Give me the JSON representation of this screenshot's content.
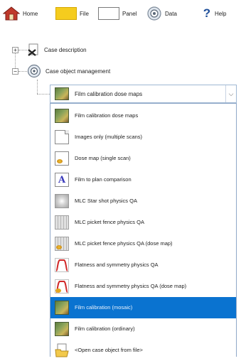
{
  "toolbar": {
    "home_label": "Home",
    "file_label": "File",
    "panel_label": "Panel",
    "data_label": "Data",
    "help_label": "Help",
    "help_glyph": "?"
  },
  "tree": {
    "nodes": [
      {
        "label": "Case description",
        "icon": "case-description-icon",
        "expander": "+"
      },
      {
        "label": "Case object management",
        "icon": "case-object-icon",
        "expander": "−"
      }
    ]
  },
  "combo": {
    "selected_label": "Film calibration dose maps",
    "selected_icon": "film-icon"
  },
  "dropdown": {
    "options": [
      {
        "label": "Film calibration dose maps",
        "icon": "film-icon",
        "selected": false
      },
      {
        "label": "Images only (multiple scans)",
        "icon": "document-icon",
        "selected": false
      },
      {
        "label": "Dose map (single scan)",
        "icon": "dose-map-icon",
        "selected": false
      },
      {
        "label": "Film to plan comparison",
        "icon": "comparison-icon",
        "selected": false
      },
      {
        "label": "MLC Star shot physics QA",
        "icon": "star-shot-icon",
        "selected": false
      },
      {
        "label": "MLC picket fence physics QA",
        "icon": "picket-fence-icon",
        "selected": false
      },
      {
        "label": "MLC picket fence physics QA (dose map)",
        "icon": "picket-fence-dose-icon",
        "selected": false
      },
      {
        "label": "Flatness and symmetry physics QA",
        "icon": "flatness-icon",
        "selected": false
      },
      {
        "label": "Flatness and symmetry physics QA (dose map)",
        "icon": "flatness-dose-icon",
        "selected": false
      },
      {
        "label": "Film calibration (mosaic)",
        "icon": "film-icon",
        "selected": true
      },
      {
        "label": "Film calibration (ordinary)",
        "icon": "film-icon",
        "selected": false
      },
      {
        "label": "<Open case object from file>",
        "icon": "open-folder-icon",
        "selected": false
      }
    ]
  },
  "colors": {
    "selection": "#0a73d0",
    "file_icon": "#f5cc1e",
    "home_roof": "#c0392b",
    "flatness_curve": "#d12a2a"
  }
}
